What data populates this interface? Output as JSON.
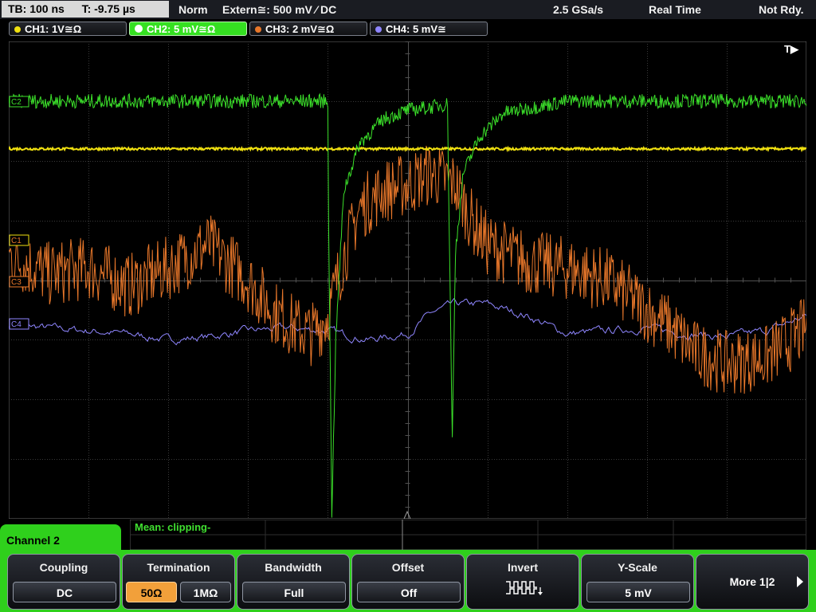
{
  "status": {
    "timebase": "TB: 100 ns",
    "trigger_time": "T: -9.75 µs",
    "mode": "Norm",
    "trigger": "Extern≅: 500 mV ⁄ DC",
    "sample_rate": "2.5 GSa/s",
    "acq_mode": "Real Time",
    "state": "Not Rdy."
  },
  "channels": [
    {
      "label": "CH1: 1V≅Ω",
      "color": "#f0e010"
    },
    {
      "label": "CH2: 5 mV≅Ω",
      "color": "#3be02a",
      "active": true
    },
    {
      "label": "CH3: 2 mV≅Ω",
      "color": "#e8772a"
    },
    {
      "label": "CH4: 5 mV≅",
      "color": "#8f86ff"
    }
  ],
  "trigger_marker": "T▶",
  "markers": {
    "c1": "C1",
    "c2": "C2",
    "c3": "C3",
    "c4": "C4"
  },
  "measurement": "Mean: clipping-",
  "menu": {
    "title": "Channel 2",
    "coupling": {
      "title": "Coupling",
      "value": "DC"
    },
    "termination": {
      "title": "Termination",
      "opt1": "50Ω",
      "opt2": "1MΩ"
    },
    "bandwidth": {
      "title": "Bandwidth",
      "value": "Full"
    },
    "offset": {
      "title": "Offset",
      "value": "Off"
    },
    "invert": {
      "title": "Invert"
    },
    "yscale": {
      "title": "Y-Scale",
      "value": "5 mV"
    },
    "more": "More 1|2"
  },
  "colors": {
    "ch1": "#f0e010",
    "ch2": "#3be02a",
    "ch3": "#e8772a",
    "ch4": "#8f86ff",
    "grid": "#3a3a3a",
    "menu": "#2fd01c",
    "selected": "#f2a03a"
  },
  "chart_data": {
    "type": "line",
    "x_divisions": 10,
    "y_divisions": 8,
    "series": [
      {
        "name": "CH1",
        "x": [
          0,
          1000
        ],
        "y": [
          2.2,
          2.2
        ]
      },
      {
        "name": "CH2",
        "x": [
          0,
          400,
          401,
          405,
          410,
          420,
          440,
          470,
          500,
          530,
          550,
          552,
          556,
          560,
          570,
          590,
          620,
          700,
          1000
        ],
        "y": [
          3.0,
          3.0,
          1.0,
          -3.9,
          -1.0,
          1.5,
          2.3,
          2.7,
          2.85,
          2.9,
          2.95,
          1.0,
          -2.7,
          0.5,
          1.8,
          2.4,
          2.8,
          3.0,
          3.0
        ]
      },
      {
        "name": "CH3",
        "x": [
          0,
          50,
          100,
          150,
          200,
          250,
          300,
          330,
          360,
          380,
          400,
          420,
          440,
          470,
          500,
          530,
          560,
          580,
          600,
          650,
          700,
          750,
          800,
          830,
          860,
          900,
          950,
          1000
        ],
        "y": [
          0.4,
          0.1,
          0.2,
          -0.1,
          0.2,
          0.6,
          0.0,
          -0.5,
          -0.8,
          -0.9,
          -0.6,
          0.4,
          1.2,
          1.5,
          1.6,
          1.8,
          1.6,
          1.0,
          0.6,
          0.3,
          0.2,
          0.0,
          -0.5,
          -0.8,
          -1.2,
          -1.4,
          -1.3,
          -0.8
        ]
      },
      {
        "name": "CH4",
        "x": [
          0,
          50,
          100,
          150,
          200,
          250,
          300,
          350,
          400,
          450,
          500,
          530,
          560,
          600,
          650,
          700,
          750,
          800,
          850,
          900,
          950,
          1000
        ],
        "y": [
          -0.75,
          -0.8,
          -0.85,
          -0.9,
          -1.0,
          -0.95,
          -0.85,
          -0.8,
          -0.85,
          -1.0,
          -0.9,
          -0.55,
          -0.4,
          -0.4,
          -0.6,
          -0.9,
          -0.85,
          -0.8,
          -0.9,
          -0.95,
          -0.85,
          -0.6
        ]
      }
    ]
  }
}
